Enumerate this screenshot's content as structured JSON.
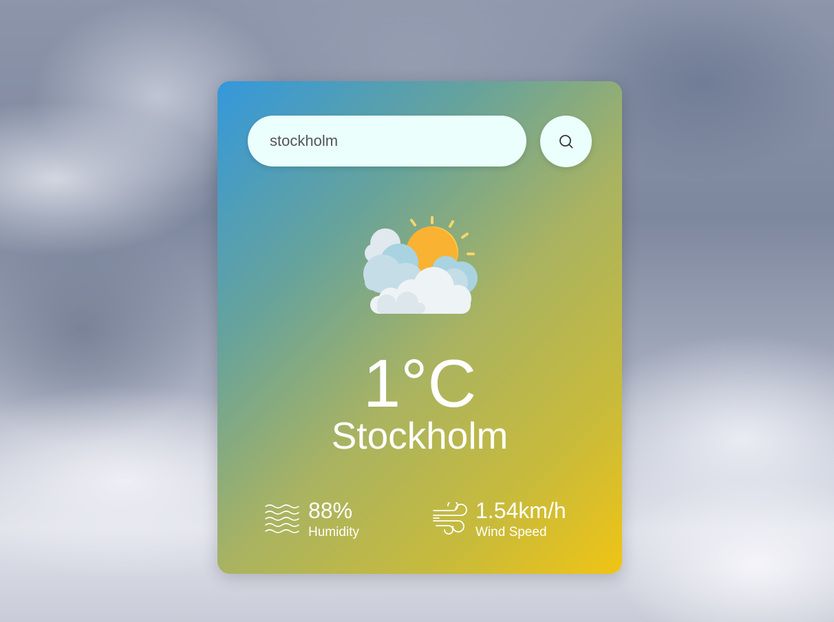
{
  "search": {
    "value": "stockholm",
    "placeholder": "",
    "button_icon": "search-icon"
  },
  "weather": {
    "condition_icon": "partly-cloudy-icon",
    "temperature": "1°C",
    "city": "Stockholm"
  },
  "details": {
    "humidity": {
      "icon": "humidity-waves-icon",
      "value": "88%",
      "label": "Humidity"
    },
    "wind": {
      "icon": "wind-icon",
      "value": "1.54km/h",
      "label": "Wind Speed"
    }
  },
  "colors": {
    "card_gradient_start": "#3498db",
    "card_gradient_end": "#f0c414",
    "input_background": "#ebfffc",
    "text": "#ffffff"
  }
}
